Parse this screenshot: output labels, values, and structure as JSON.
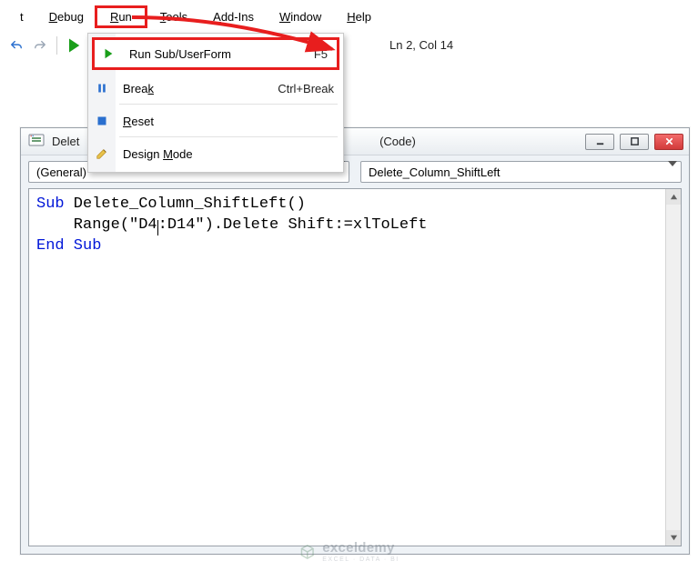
{
  "menubar": {
    "items": [
      {
        "html": "t"
      },
      {
        "html": "<u>D</u>ebug"
      },
      {
        "html": "<u>R</u>un"
      },
      {
        "html": "<u>T</u>ools"
      },
      {
        "html": "<u>A</u>dd-Ins"
      },
      {
        "html": "<u>W</u>indow"
      },
      {
        "html": "<u>H</u>elp"
      }
    ]
  },
  "toolbar": {
    "status_text": "Ln 2, Col 14"
  },
  "run_menu": {
    "items": [
      {
        "label": "Run Sub/UserForm",
        "shortcut": "F5",
        "icon": "play-icon"
      },
      {
        "label_html": "Brea<u>k</u>",
        "shortcut": "Ctrl+Break",
        "icon": "pause-icon"
      },
      {
        "label_html": "<u>R</u>eset",
        "shortcut": "",
        "icon": "stop-icon"
      },
      {
        "label_html": "Design <u>M</u>ode",
        "shortcut": "",
        "icon": "design-icon"
      }
    ]
  },
  "code_window": {
    "title_prefix": "Delet",
    "title_suffix": "(Code)",
    "left_dropdown": "(General)",
    "right_dropdown": "Delete_Column_ShiftLeft",
    "code": {
      "line1_kw": "Sub",
      "line1_rest": " Delete_Column_ShiftLeft()",
      "line2_pre": "    Range(\"D4",
      "line2_post": ":D14\").Delete Shift:=xlToLeft",
      "line3": "End Sub"
    }
  },
  "watermark": {
    "name": "exceldemy",
    "sub": "EXCEL · DATA · BI"
  }
}
